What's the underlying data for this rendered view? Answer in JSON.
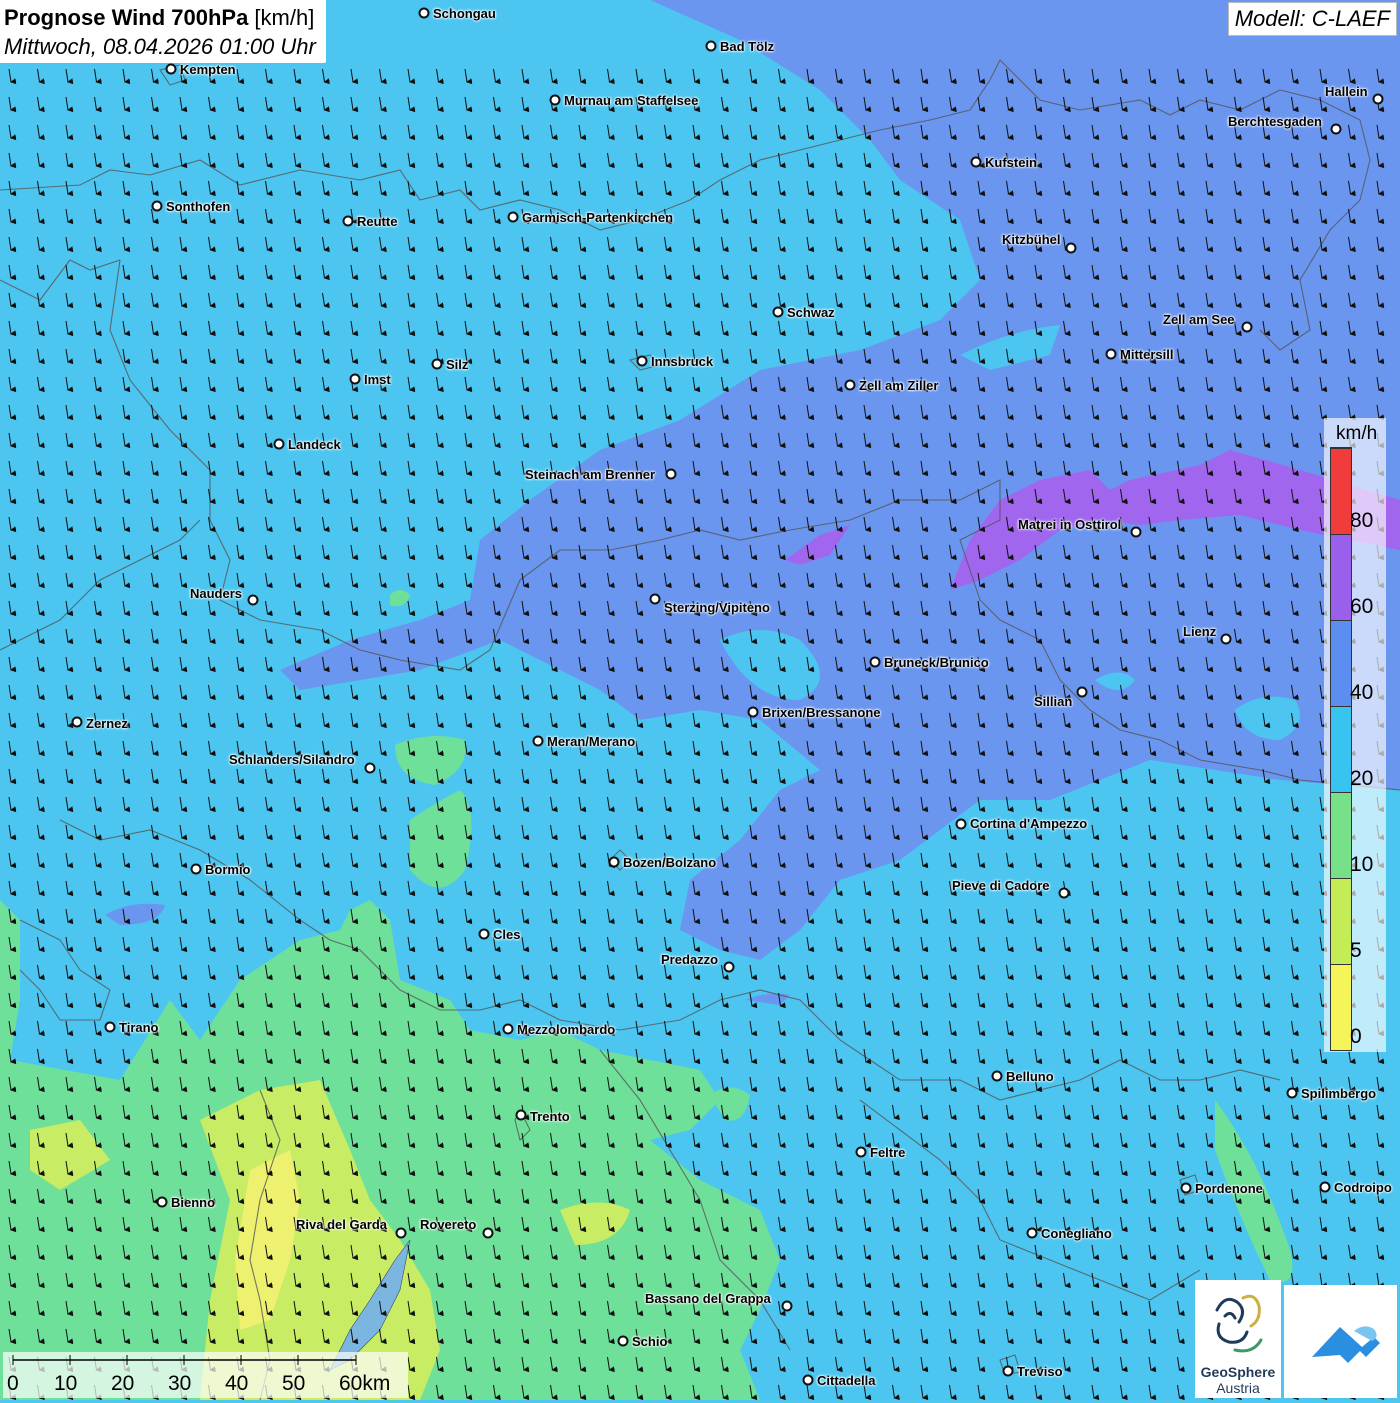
{
  "title": {
    "main_bold": "Prognose Wind 700hPa",
    "unit": " [km/h]",
    "datetime": "Mittwoch, 08.04.2026 01:00 Uhr"
  },
  "model": "Modell: C-LAEF",
  "legend": {
    "unit": "km/h",
    "ticks": [
      "0",
      "5",
      "10",
      "20",
      "40",
      "60",
      "80"
    ],
    "colors": [
      "#f5f55a",
      "#c4ec56",
      "#78e088",
      "#38c4f0",
      "#5b8ef0",
      "#9a60ec",
      "#f03c3c"
    ]
  },
  "scale_bar": {
    "labels": [
      "0",
      "10",
      "20",
      "30",
      "40",
      "50",
      "60km"
    ]
  },
  "logos": {
    "geosphere_line1": "GeoSphere",
    "geosphere_line2": "Austria"
  },
  "cities": [
    {
      "name": "Schongau"
    },
    {
      "name": "Bad Tölz"
    },
    {
      "name": "Kempten"
    },
    {
      "name": "Murnau am Staffelsee"
    },
    {
      "name": "Hallein"
    },
    {
      "name": "Berchtesgaden"
    },
    {
      "name": "Kufstein"
    },
    {
      "name": "Sonthofen"
    },
    {
      "name": "Reutte"
    },
    {
      "name": "Garmisch-Partenkirchen"
    },
    {
      "name": "Kitzbühel"
    },
    {
      "name": "Schwaz"
    },
    {
      "name": "Zell am See"
    },
    {
      "name": "Mittersill"
    },
    {
      "name": "Innsbruck"
    },
    {
      "name": "Silz"
    },
    {
      "name": "Imst"
    },
    {
      "name": "Zell am Ziller"
    },
    {
      "name": "Landeck"
    },
    {
      "name": "Steinach am Brenner"
    },
    {
      "name": "Matrei in Osttirol"
    },
    {
      "name": "Nauders"
    },
    {
      "name": "Sterzing/Vipiteno"
    },
    {
      "name": "Lienz"
    },
    {
      "name": "Bruneck/Brunico"
    },
    {
      "name": "Sillian"
    },
    {
      "name": "Brixen/Bressanone"
    },
    {
      "name": "Zernez"
    },
    {
      "name": "Meran/Merano"
    },
    {
      "name": "Schlanders/Silandro"
    },
    {
      "name": "Cortina d'Ampezzo"
    },
    {
      "name": "Bozen/Bolzano"
    },
    {
      "name": "Bormio"
    },
    {
      "name": "Pieve di Cadore"
    },
    {
      "name": "Cles"
    },
    {
      "name": "Predazzo"
    },
    {
      "name": "Tirano"
    },
    {
      "name": "Mezzolombardo"
    },
    {
      "name": "Belluno"
    },
    {
      "name": "Spilimbergo"
    },
    {
      "name": "Trento"
    },
    {
      "name": "Feltre"
    },
    {
      "name": "Pordenone"
    },
    {
      "name": "Codroipo"
    },
    {
      "name": "Bienno"
    },
    {
      "name": "Riva del Garda"
    },
    {
      "name": "Rovereto"
    },
    {
      "name": "Conegliano"
    },
    {
      "name": "Bassano del Grappa"
    },
    {
      "name": "Schio"
    },
    {
      "name": "Treviso"
    },
    {
      "name": "Cittadella"
    }
  ]
}
